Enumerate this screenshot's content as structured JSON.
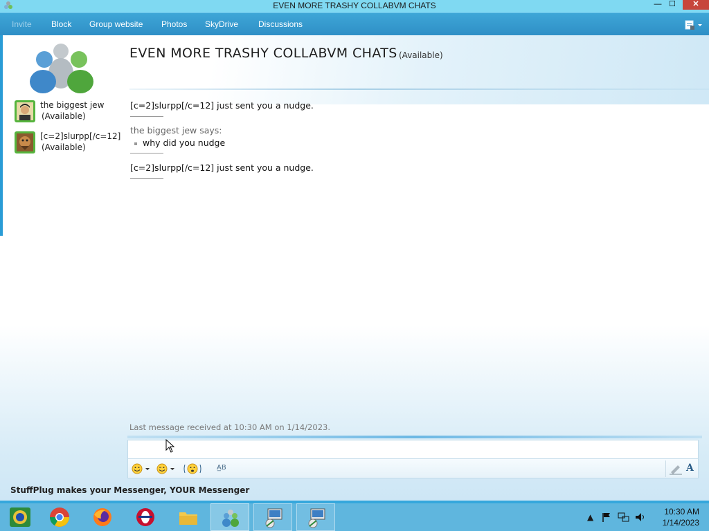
{
  "window": {
    "title": "EVEN MORE TRASHY COLLABVM CHATS",
    "minimize_glyph": "—",
    "maximize_glyph": "☐",
    "close_glyph": "✕"
  },
  "menu": {
    "items": [
      {
        "label": "Invite",
        "enabled": false
      },
      {
        "label": "Block",
        "enabled": true
      },
      {
        "label": "Group website",
        "enabled": true
      },
      {
        "label": "Photos",
        "enabled": true
      },
      {
        "label": "SkyDrive",
        "enabled": true
      },
      {
        "label": "Discussions",
        "enabled": true
      }
    ],
    "menu_icon": "menu-options-icon"
  },
  "header": {
    "group_name": "EVEN MORE TRASHY COLLABVM CHATS",
    "status": "(Available)"
  },
  "contacts": [
    {
      "name": "the biggest jew",
      "status": "(Available)"
    },
    {
      "name": "[c=2]slurpp[/c=12]",
      "status": "(Available)"
    }
  ],
  "conversation": {
    "nudge_1": "[c=2]slurpp[/c=12] just sent you a nudge.",
    "sender": "the biggest jew says:",
    "message": "why did you nudge",
    "nudge_2": "[c=2]slurpp[/c=12] just sent you a nudge."
  },
  "last_message": "Last message received at 10:30 AM on 1/14/2023.",
  "input": {
    "value": "",
    "toolbar": [
      "emoticon-icon",
      "wink-icon",
      "nudge-icon",
      "spell-check-icon",
      "handwriting-icon",
      "font-icon"
    ]
  },
  "status_bar": "StuffPlug makes your Messenger, YOUR Messenger",
  "taskbar": {
    "apps": [
      "start-orb",
      "chrome",
      "firefox",
      "opera",
      "file-explorer",
      "messenger",
      "remote-desktop-1",
      "remote-desktop-2"
    ],
    "clock_time": "10:30 AM",
    "clock_date": "1/14/2023"
  },
  "colors": {
    "menubar": "#2f8fc6",
    "accent": "#35a7dc",
    "close_button": "#c7463c"
  }
}
